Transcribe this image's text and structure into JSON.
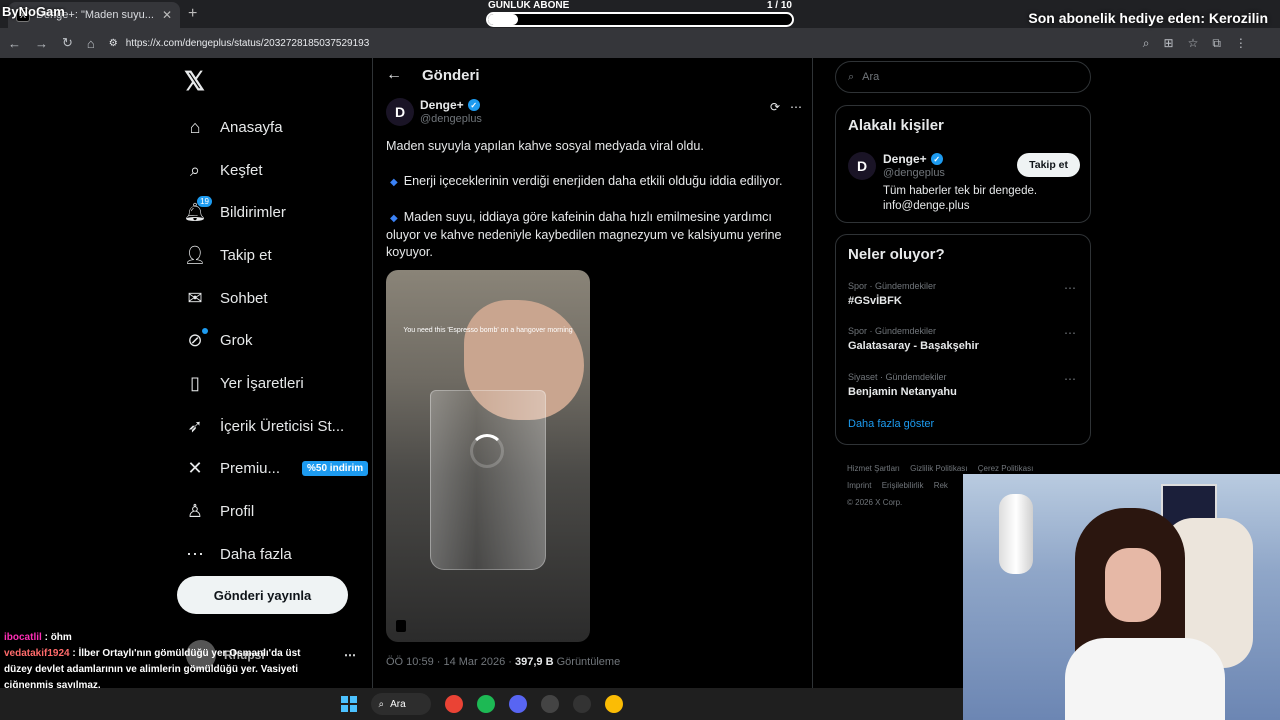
{
  "browser": {
    "tab_title": "Denge+: \"Maden suyu...",
    "url": "https://x.com/dengeplus/status/2032728185037529193"
  },
  "overlay": {
    "stream_logo": "ByNoGam",
    "abone_label": "GÜNLÜK ABONE",
    "abone_count": "1 / 10",
    "abone_progress": 0.1,
    "hediye_text": "Son abonelik hediye eden: Kerozilin"
  },
  "nav": {
    "items": [
      {
        "label": "Anasayfa",
        "icon": "home-icon"
      },
      {
        "label": "Keşfet",
        "icon": "search-icon"
      },
      {
        "label": "Bildirimler",
        "icon": "bell-icon",
        "badge": "19"
      },
      {
        "label": "Takip et",
        "icon": "person-add-icon"
      },
      {
        "label": "Sohbet",
        "icon": "mail-icon"
      },
      {
        "label": "Grok",
        "icon": "grok-icon"
      },
      {
        "label": "Yer İşaretleri",
        "icon": "bookmark-icon"
      },
      {
        "label": "İçerik Üreticisi St...",
        "icon": "rocket-icon"
      },
      {
        "label": "Premiu...",
        "icon": "x-icon",
        "promo": "%50 indirim"
      },
      {
        "label": "Profil",
        "icon": "profile-icon"
      },
      {
        "label": "Daha fazla",
        "icon": "more-icon"
      }
    ],
    "post_button": "Gönderi yayınla",
    "account_name": "Rhupsi"
  },
  "main": {
    "title": "Gönderi",
    "author_name": "Denge+",
    "author_handle": "@dengeplus",
    "tweet_p1": "Maden suyuyla yapılan kahve sosyal medyada viral oldu.",
    "tweet_p2": "Enerji içeceklerinin verdiği enerjiden daha etkili olduğu iddia ediliyor.",
    "tweet_p3": "Maden suyu, iddiaya göre kafeinin daha hızlı emilmesine yardımcı oluyor ve kahve nedeniyle kaybedilen magnezyum ve kalsiyumu yerine koyuyor.",
    "media_caption": "You need this 'Espresso bomb' on a hangover morning",
    "time": "ÖÖ 10:59 · 14 Mar 2026 · ",
    "views_count": "397,9 B",
    "views_label": " Görüntüleme"
  },
  "right": {
    "search_placeholder": "Ara",
    "related_title": "Alakalı kişiler",
    "related_name": "Denge+",
    "related_handle": "@dengeplus",
    "related_bio": "Tüm haberler tek bir dengede. info@denge.plus",
    "follow_label": "Takip et",
    "trends_title": "Neler oluyor?",
    "trends": [
      {
        "category": "Spor · Gündemdekiler",
        "name": "#GSvİBFK"
      },
      {
        "category": "Spor · Gündemdekiler",
        "name": "Galatasaray - Başakşehir"
      },
      {
        "category": "Siyaset · Gündemdekiler",
        "name": "Benjamin Netanyahu"
      }
    ],
    "show_more": "Daha fazla göster",
    "footer": [
      "Hizmet Şartları",
      "Gizlilik Politikası",
      "Çerez Politikası",
      "Imprint",
      "Erişilebilirlik",
      "Rek",
      "© 2026 X Corp."
    ]
  },
  "chat": [
    {
      "user": "ibocatlil",
      "text": "öhm"
    },
    {
      "user": "vedatakif1924",
      "text": "İlber Ortaylı'nın gömüldüğü yer Osmanlı'da üst düzey devlet adamlarının ve alimlerin gömüldüğü yer. Vasiyeti çiğnenmiş sayılmaz."
    }
  ],
  "taskbar": {
    "search_label": "Ara"
  },
  "colors": {
    "accent": "#1d9bf0",
    "background": "#000000",
    "border": "#2f3336"
  }
}
